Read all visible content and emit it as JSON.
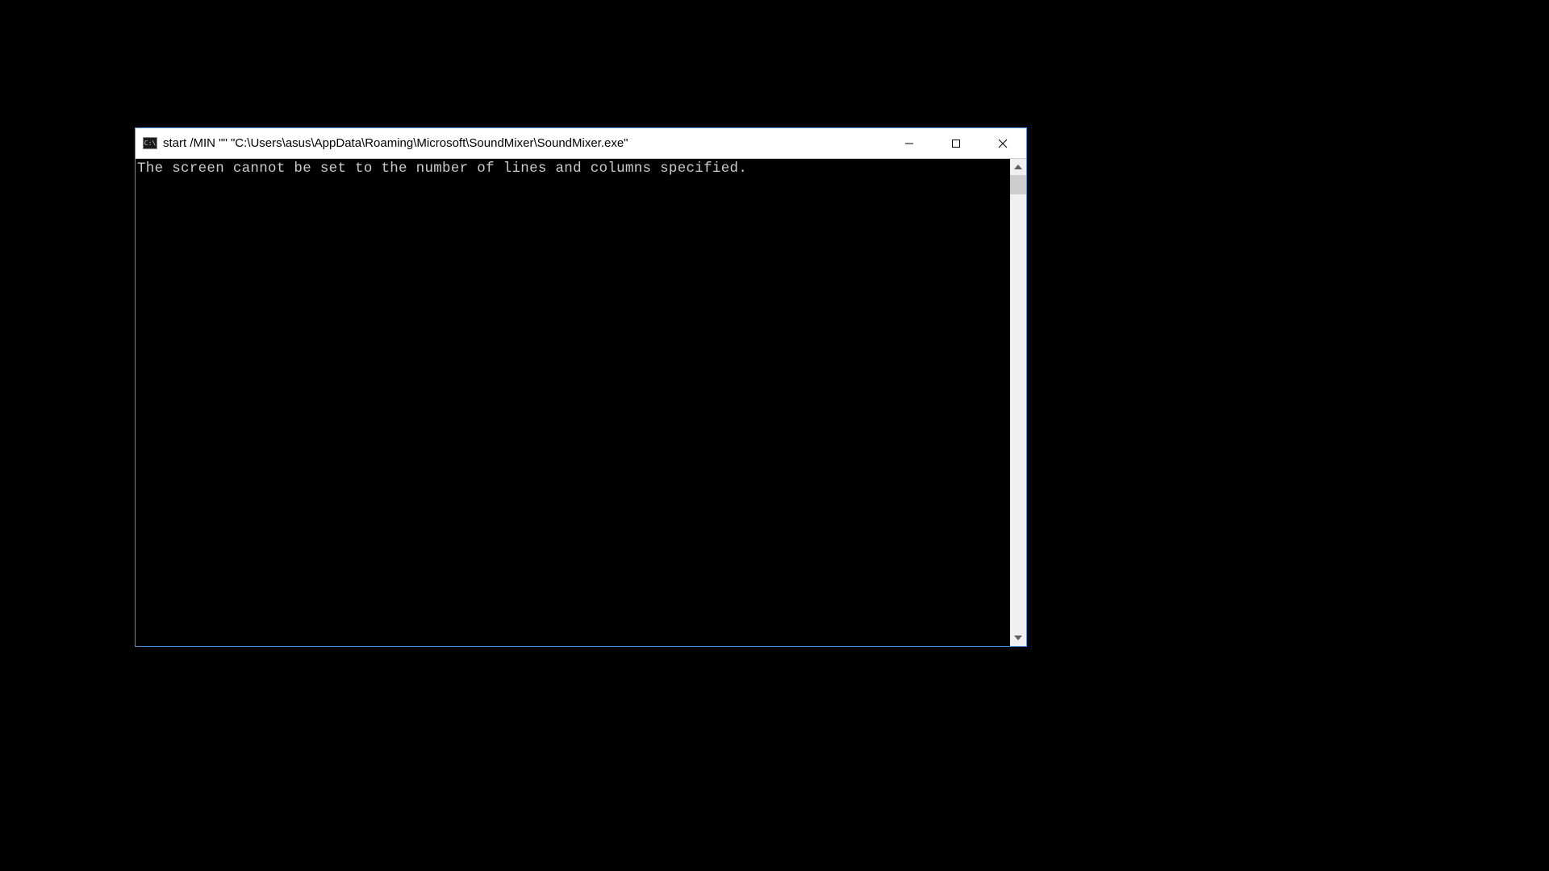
{
  "window": {
    "title": "start  /MIN \"\" \"C:\\Users\\asus\\AppData\\Roaming\\Microsoft\\SoundMixer\\SoundMixer.exe\"",
    "icon_label": "C:\\"
  },
  "terminal": {
    "output": "The screen cannot be set to the number of lines and columns specified."
  }
}
